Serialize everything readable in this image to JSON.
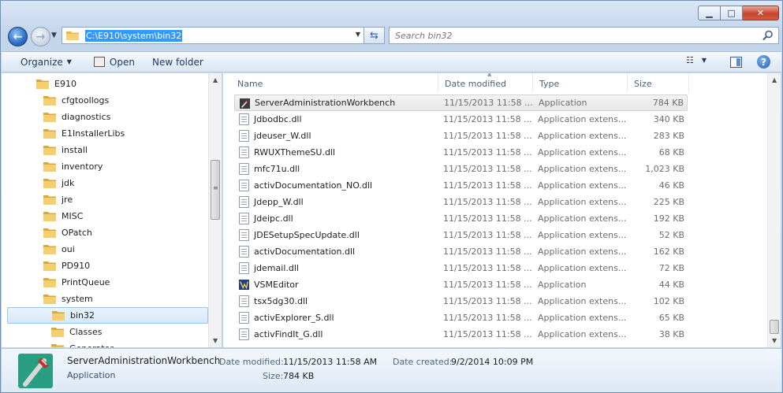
{
  "address": {
    "path": "C:\\E910\\system\\bin32"
  },
  "search": {
    "placeholder": "Search bin32"
  },
  "toolbar": {
    "organize": "Organize",
    "open": "Open",
    "new_folder": "New folder"
  },
  "nav_tree": [
    {
      "label": "E910",
      "indent": 0
    },
    {
      "label": "cfgtoollogs",
      "indent": 1
    },
    {
      "label": "diagnostics",
      "indent": 1
    },
    {
      "label": "E1InstallerLibs",
      "indent": 1
    },
    {
      "label": "install",
      "indent": 1
    },
    {
      "label": "inventory",
      "indent": 1
    },
    {
      "label": "jdk",
      "indent": 1
    },
    {
      "label": "jre",
      "indent": 1
    },
    {
      "label": "MISC",
      "indent": 1
    },
    {
      "label": "OPatch",
      "indent": 1
    },
    {
      "label": "oui",
      "indent": 1
    },
    {
      "label": "PD910",
      "indent": 1
    },
    {
      "label": "PrintQueue",
      "indent": 1
    },
    {
      "label": "system",
      "indent": 1
    },
    {
      "label": "bin32",
      "indent": 2,
      "selected": true
    },
    {
      "label": "Classes",
      "indent": 2
    },
    {
      "label": "Generator",
      "indent": 2
    }
  ],
  "columns": {
    "name": "Name",
    "date": "Date modified",
    "type": "Type",
    "size": "Size"
  },
  "files": [
    {
      "name": "ServerAdministrationWorkbench",
      "date": "11/15/2013 11:58 ...",
      "type": "Application",
      "size": "784 KB",
      "icon": "workbench-icon",
      "selected": true
    },
    {
      "name": "Jdbodbc.dll",
      "date": "11/15/2013 11:58 ...",
      "type": "Application extens...",
      "size": "340 KB",
      "icon": "dll-icon"
    },
    {
      "name": "jdeuser_W.dll",
      "date": "11/15/2013 11:58 ...",
      "type": "Application extens...",
      "size": "283 KB",
      "icon": "dll-icon"
    },
    {
      "name": "RWUXThemeSU.dll",
      "date": "11/15/2013 11:58 ...",
      "type": "Application extens...",
      "size": "68 KB",
      "icon": "dll-icon"
    },
    {
      "name": "mfc71u.dll",
      "date": "11/15/2013 11:58 ...",
      "type": "Application extens...",
      "size": "1,023 KB",
      "icon": "dll-icon"
    },
    {
      "name": "activDocumentation_NO.dll",
      "date": "11/15/2013 11:58 ...",
      "type": "Application extens...",
      "size": "46 KB",
      "icon": "dll-icon"
    },
    {
      "name": "Jdepp_W.dll",
      "date": "11/15/2013 11:58 ...",
      "type": "Application extens...",
      "size": "225 KB",
      "icon": "dll-icon"
    },
    {
      "name": "Jdeipc.dll",
      "date": "11/15/2013 11:58 ...",
      "type": "Application extens...",
      "size": "192 KB",
      "icon": "dll-icon"
    },
    {
      "name": "JDESetupSpecUpdate.dll",
      "date": "11/15/2013 11:58 ...",
      "type": "Application extens...",
      "size": "52 KB",
      "icon": "dll-icon"
    },
    {
      "name": "activDocumentation.dll",
      "date": "11/15/2013 11:58 ...",
      "type": "Application extens...",
      "size": "162 KB",
      "icon": "dll-icon"
    },
    {
      "name": "jdemail.dll",
      "date": "11/15/2013 11:58 ...",
      "type": "Application extens...",
      "size": "72 KB",
      "icon": "dll-icon"
    },
    {
      "name": "VSMEditor",
      "date": "11/15/2013 11:58 ...",
      "type": "Application",
      "size": "44 KB",
      "icon": "vsm-editor-icon"
    },
    {
      "name": "tsx5dg30.dll",
      "date": "11/15/2013 11:58 ...",
      "type": "Application extens...",
      "size": "102 KB",
      "icon": "dll-icon"
    },
    {
      "name": "activExplorer_S.dll",
      "date": "11/15/2013 11:58 ...",
      "type": "Application extens...",
      "size": "65 KB",
      "icon": "dll-icon"
    },
    {
      "name": "activFindIt_G.dll",
      "date": "11/15/2013 11:58 ...",
      "type": "Application extens...",
      "size": "38 KB",
      "icon": "dll-icon"
    }
  ],
  "details": {
    "name": "ServerAdministrationWorkbench",
    "type": "Application",
    "date_modified_label": "Date modified:",
    "date_modified": "11/15/2013 11:58 AM",
    "date_created_label": "Date created:",
    "date_created": "9/2/2014 10:09 PM",
    "size_label": "Size:",
    "size": "784 KB"
  }
}
